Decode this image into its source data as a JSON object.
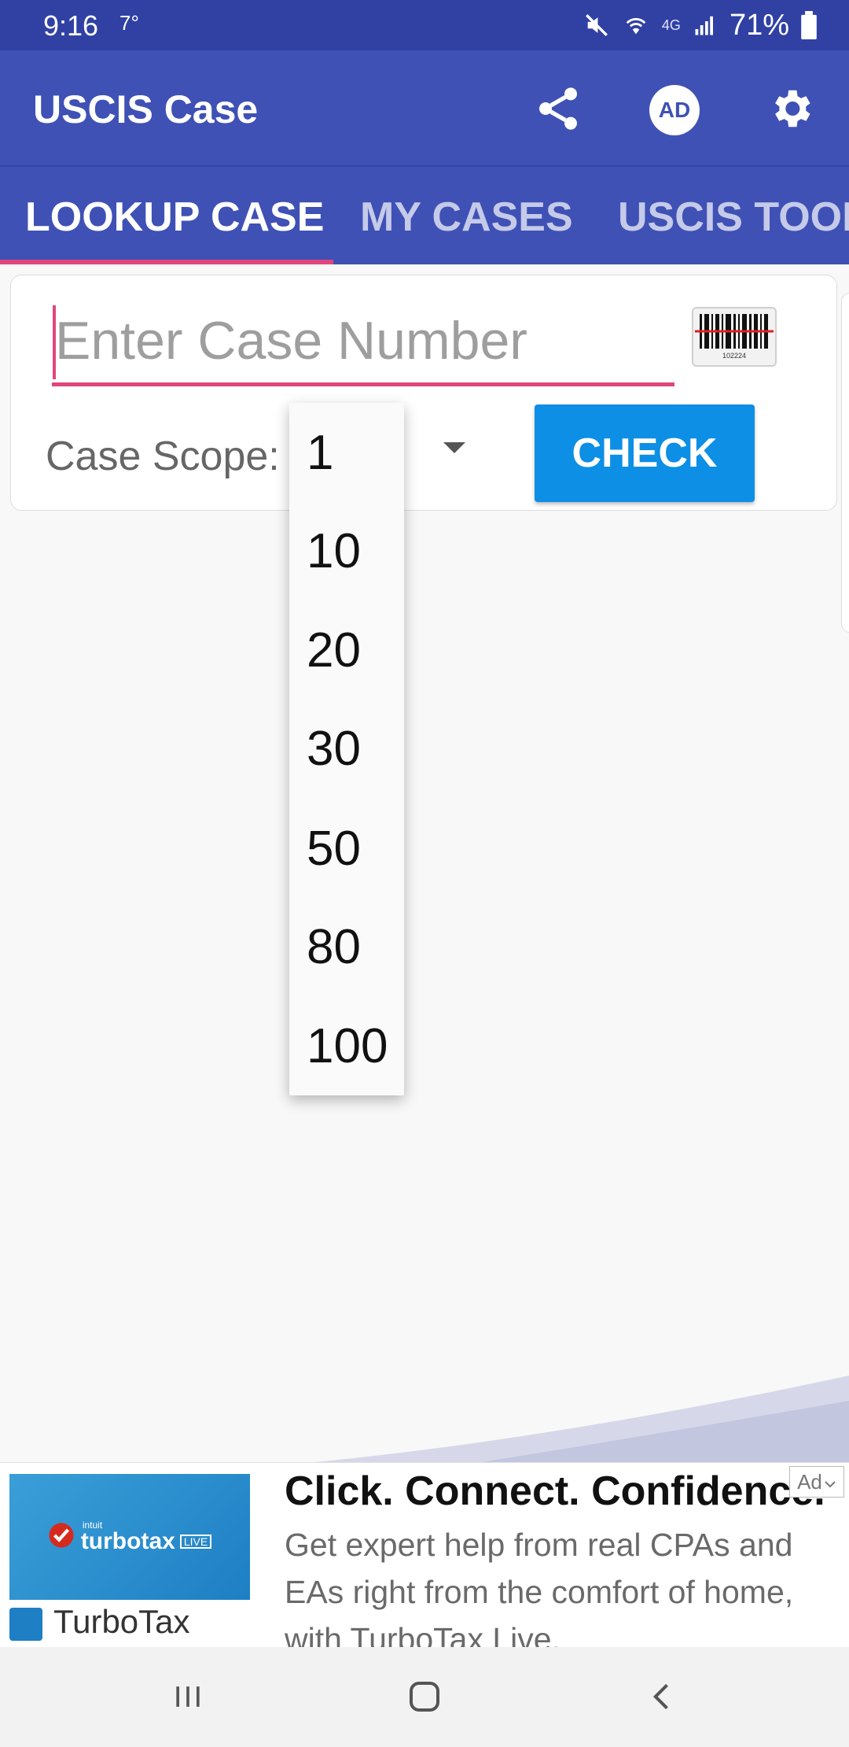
{
  "status_bar": {
    "time": "9:16",
    "temperature": "7°",
    "network": "4G",
    "battery": "71%"
  },
  "app_bar": {
    "title": "USCIS Case",
    "actions": {
      "share_icon": "share-icon",
      "ad_badge": "AD",
      "settings_icon": "gear-icon"
    }
  },
  "tabs": [
    {
      "label": "LOOKUP CASE",
      "active": true
    },
    {
      "label": "MY CASES",
      "active": false
    },
    {
      "label": "USCIS TOOL",
      "active": false
    }
  ],
  "lookup": {
    "placeholder": "Enter Case Number",
    "value": "",
    "scope_label": "Case Scope:",
    "check_label": "CHECK",
    "barcode_digits": "102224"
  },
  "scope_options": [
    "1",
    "10",
    "20",
    "30",
    "50",
    "80",
    "100"
  ],
  "ad": {
    "headline": "Click. Connect. Confidence.",
    "body": "Get expert help from real CPAs and EAs right from the comfort of home, with TurboTax Live.",
    "brand": "TurboTax",
    "logo_small": "intuit",
    "logo_main": "turbotax",
    "logo_badge": "LIVE",
    "label": "Ad"
  },
  "colors": {
    "primary": "#3f51b5",
    "status": "#3140a3",
    "accent": "#e0457b",
    "button": "#0c8fe5"
  }
}
